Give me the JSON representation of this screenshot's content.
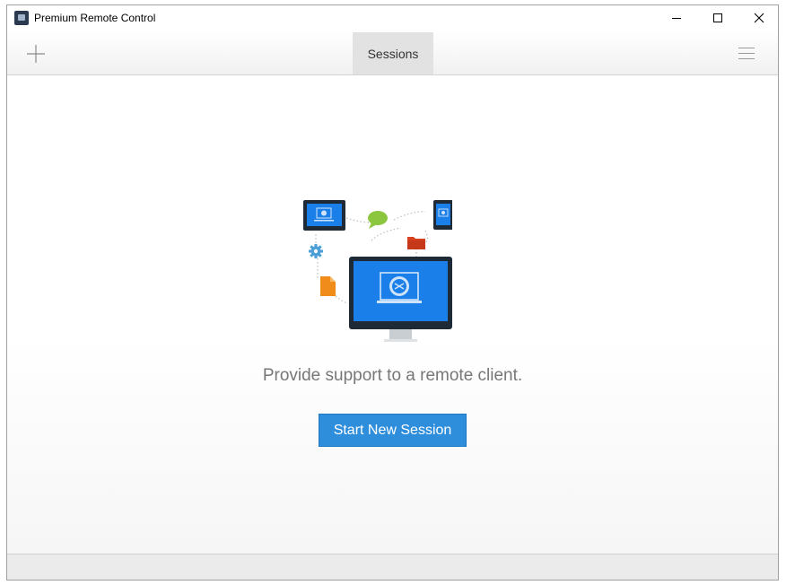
{
  "window": {
    "title": "Premium Remote Control"
  },
  "toolbar": {
    "add_icon": "plus-icon",
    "tabs": [
      {
        "label": "Sessions",
        "active": true
      }
    ],
    "menu_icon": "hamburger-menu-icon"
  },
  "main": {
    "illustration": "remote-support-devices-illustration",
    "tagline": "Provide support to a remote client.",
    "start_button": "Start New Session"
  },
  "colors": {
    "accent": "#2e8edb",
    "screen_blue": "#1a7fe8",
    "monitor_frame": "#1e2a36",
    "chat_green": "#8cc63f",
    "folder_red": "#d9411e",
    "file_orange": "#f08c1a",
    "gear_blue": "#4a9fd8"
  }
}
